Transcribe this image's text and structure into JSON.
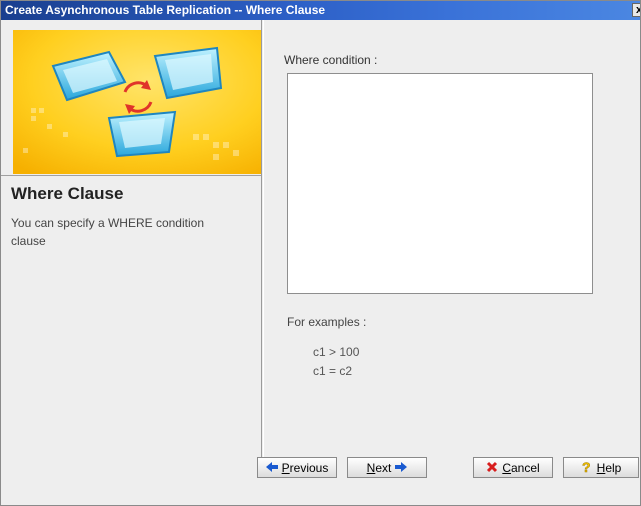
{
  "window": {
    "title": "Create Asynchronous Table Replication -- Where Clause",
    "close_glyph": "x"
  },
  "sidebar": {
    "title": "Where Clause",
    "description": "You can specify a WHERE condition clause"
  },
  "main": {
    "where_label": "Where condition :",
    "where_value": "",
    "examples_label": "For examples :",
    "examples": [
      "c1 > 100",
      "c1 = c2"
    ]
  },
  "buttons": {
    "previous": {
      "mnemonic": "P",
      "rest": "revious"
    },
    "next": {
      "mnemonic": "N",
      "rest": "ext"
    },
    "cancel": {
      "mnemonic": "C",
      "rest": "ancel"
    },
    "help": {
      "mnemonic": "H",
      "rest": "elp"
    }
  },
  "colors": {
    "title_bar": "#2c5fc6",
    "banner_bg": "#ffcc22",
    "arrow_blue": "#1a5ad0",
    "cancel_red": "#d81e1e",
    "help_yellow": "#f2c200"
  }
}
